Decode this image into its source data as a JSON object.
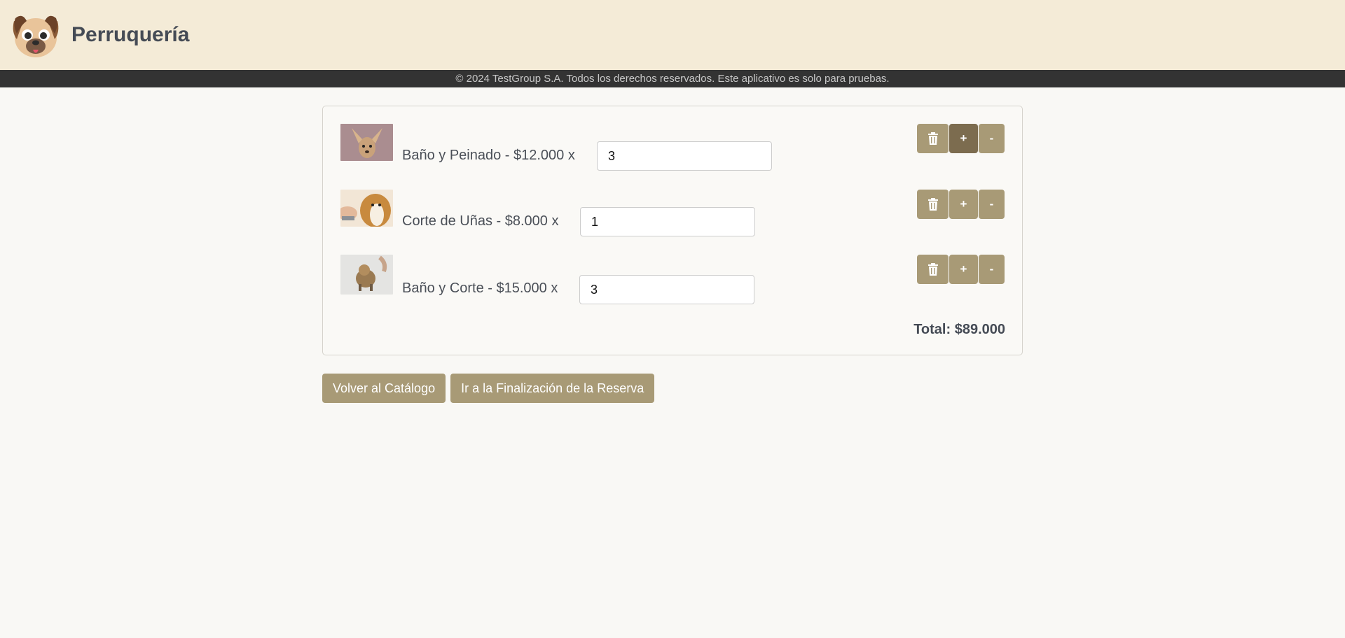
{
  "header": {
    "brand": "Perruquería",
    "logo_icon": "pug-logo-icon"
  },
  "footer": {
    "text": "© 2024 TestGroup S.A. Todos los derechos reservados. Este aplicativo es solo para pruebas."
  },
  "cart": {
    "items": [
      {
        "label": "Baño y Peinado - $12.000 x",
        "quantity": "3",
        "thumb": "chihuahua-photo"
      },
      {
        "label": "Corte de Uñas - $8.000 x",
        "quantity": "1",
        "thumb": "collie-nail-trim-photo"
      },
      {
        "label": "Baño y Corte - $15.000 x",
        "quantity": "3",
        "thumb": "yorkie-grooming-photo"
      }
    ],
    "delete_icon": "trash-icon",
    "add_label": "+",
    "remove_label": "-",
    "total": "Total: $89.000"
  },
  "actions": {
    "back_label": "Volver al Catálogo",
    "checkout_label": "Ir a la Finalización de la Reserva"
  },
  "colors": {
    "header_bg": "#f4ebd7",
    "footer_bg": "#333333",
    "button": "#a89a76",
    "button_active": "#7c6c4f"
  }
}
